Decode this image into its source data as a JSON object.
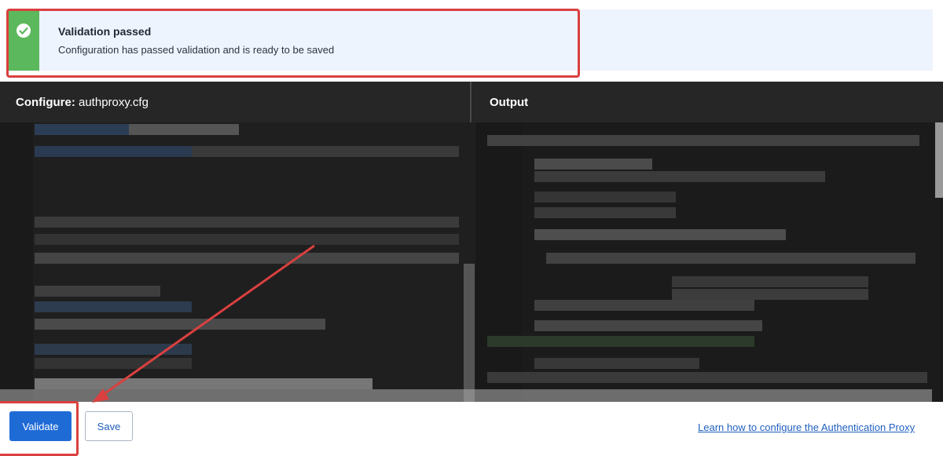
{
  "alert": {
    "title": "Validation passed",
    "message": "Configuration has passed validation and is ready to be saved",
    "icon": "check-circle-icon",
    "stripe_color": "#5cb85c"
  },
  "config_panel": {
    "label": "Configure:",
    "filename": "authproxy.cfg"
  },
  "output_panel": {
    "label": "Output"
  },
  "buttons": {
    "validate_label": "Validate",
    "save_label": "Save"
  },
  "help_link": {
    "text": "Learn how to configure the Authentication Proxy"
  },
  "colors": {
    "primary": "#1f6bd6",
    "annotation": "#d9403f",
    "link": "#1f5fbf"
  }
}
